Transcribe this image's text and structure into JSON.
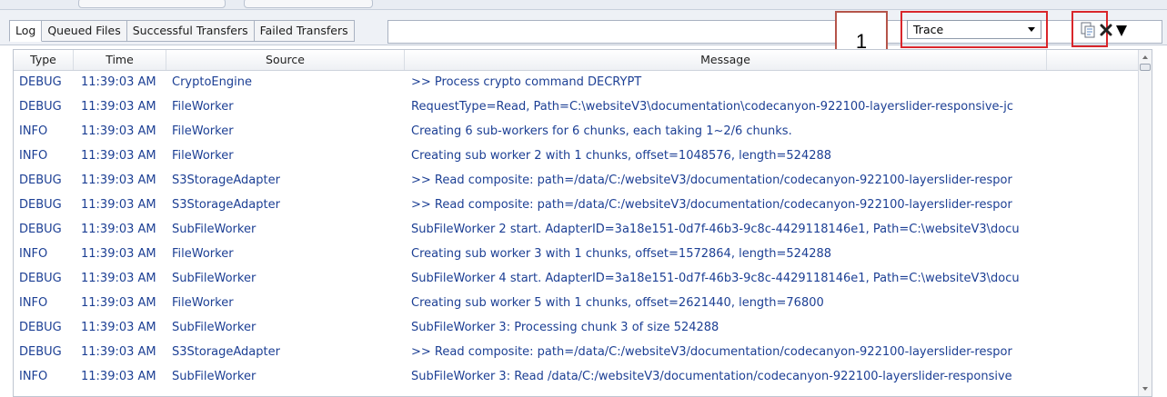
{
  "tabs": [
    "Log",
    "Queued Files",
    "Successful Transfers",
    "Failed Transfers"
  ],
  "callout_number": "1",
  "log_level": {
    "selected": "Trace"
  },
  "icons": {
    "copy": "copy-icon",
    "clear": "clear-icon",
    "menu": "menu-dropdown-icon"
  },
  "columns": {
    "type": "Type",
    "time": "Time",
    "source": "Source",
    "message": "Message"
  },
  "rows": [
    {
      "type": "DEBUG",
      "time": "11:39:03 AM",
      "source": "CryptoEngine",
      "message": ">> Process crypto command DECRYPT"
    },
    {
      "type": "DEBUG",
      "time": "11:39:03 AM",
      "source": "FileWorker",
      "message": "RequestType=Read, Path=C:\\websiteV3\\documentation\\codecanyon-922100-layerslider-responsive-jc"
    },
    {
      "type": "INFO",
      "time": "11:39:03 AM",
      "source": "FileWorker",
      "message": "Creating 6 sub-workers for 6 chunks, each taking 1~2/6 chunks."
    },
    {
      "type": "INFO",
      "time": "11:39:03 AM",
      "source": "FileWorker",
      "message": "Creating sub worker 2 with 1 chunks, offset=1048576, length=524288"
    },
    {
      "type": "DEBUG",
      "time": "11:39:03 AM",
      "source": "S3StorageAdapter",
      "message": ">> Read composite: path=/data/C:/websiteV3/documentation/codecanyon-922100-layerslider-respor"
    },
    {
      "type": "DEBUG",
      "time": "11:39:03 AM",
      "source": "S3StorageAdapter",
      "message": ">> Read composite: path=/data/C:/websiteV3/documentation/codecanyon-922100-layerslider-respor"
    },
    {
      "type": "DEBUG",
      "time": "11:39:03 AM",
      "source": "SubFileWorker",
      "message": "SubFileWorker 2 start. AdapterID=3a18e151-0d7f-46b3-9c8c-4429118146e1, Path=C:\\websiteV3\\docu"
    },
    {
      "type": "INFO",
      "time": "11:39:03 AM",
      "source": "FileWorker",
      "message": "Creating sub worker 3 with 1 chunks, offset=1572864, length=524288"
    },
    {
      "type": "DEBUG",
      "time": "11:39:03 AM",
      "source": "SubFileWorker",
      "message": "SubFileWorker 4 start. AdapterID=3a18e151-0d7f-46b3-9c8c-4429118146e1, Path=C:\\websiteV3\\docu"
    },
    {
      "type": "INFO",
      "time": "11:39:03 AM",
      "source": "FileWorker",
      "message": "Creating sub worker 5 with 1 chunks, offset=2621440, length=76800"
    },
    {
      "type": "DEBUG",
      "time": "11:39:03 AM",
      "source": "SubFileWorker",
      "message": "SubFileWorker 3: Processing chunk 3 of size 524288"
    },
    {
      "type": "DEBUG",
      "time": "11:39:03 AM",
      "source": "S3StorageAdapter",
      "message": ">> Read composite: path=/data/C:/websiteV3/documentation/codecanyon-922100-layerslider-respor"
    },
    {
      "type": "INFO",
      "time": "11:39:03 AM",
      "source": "SubFileWorker",
      "message": "SubFileWorker 3: Read /data/C:/websiteV3/documentation/codecanyon-922100-layerslider-responsive"
    }
  ],
  "colors": {
    "text_blue": "#1c3f94",
    "annotation_red": "#d9262b",
    "callout_border": "#b5544a"
  }
}
